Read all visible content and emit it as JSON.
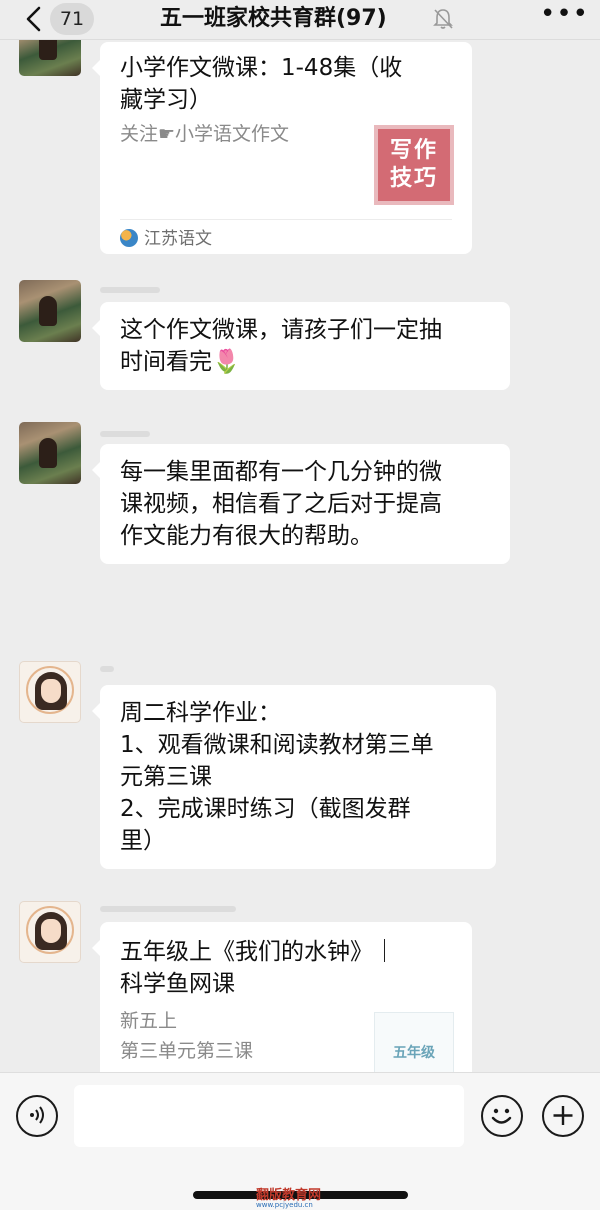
{
  "header": {
    "back_badge": "71",
    "title": "五一班家校共育群(97)",
    "more_label": "•••"
  },
  "messages": [
    {
      "type": "card",
      "title_lines": [
        "小学作文微课：1-48集（收",
        "藏学习）"
      ],
      "desc_lines": [
        "关注☛小学语文作文"
      ],
      "thumb_text": [
        "写作",
        "技巧"
      ],
      "source": "江苏语文"
    },
    {
      "type": "text",
      "lines": [
        "这个作文微课，请孩子们一定抽",
        "时间看完🌷"
      ]
    },
    {
      "type": "text",
      "lines": [
        "每一集里面都有一个几分钟的微",
        "课视频，相信看了之后对于提高",
        "作文能力有很大的帮助。"
      ]
    },
    {
      "type": "text",
      "lines": [
        "周二科学作业：",
        "1、观看微课和阅读教材第三单",
        "元第三课",
        "2、完成课时练习（截图发群",
        "里）"
      ]
    },
    {
      "type": "card",
      "title_lines": [
        "五年级上《我们的水钟》｜",
        "科学鱼网课"
      ],
      "desc_lines": [
        "新五上",
        "第三单元第三课"
      ],
      "thumb_text": [
        "五年级"
      ]
    }
  ],
  "input_bar": {
    "voice_icon": "voice-icon",
    "emoji_icon": "emoji-icon",
    "plus_icon": "plus-icon"
  },
  "watermark": {
    "main": "翻版教育网",
    "sub": "www.pcjyedu.cn"
  },
  "colors": {
    "background": "#ededed",
    "bubble": "#ffffff",
    "thumb_red": "#d36b74"
  }
}
